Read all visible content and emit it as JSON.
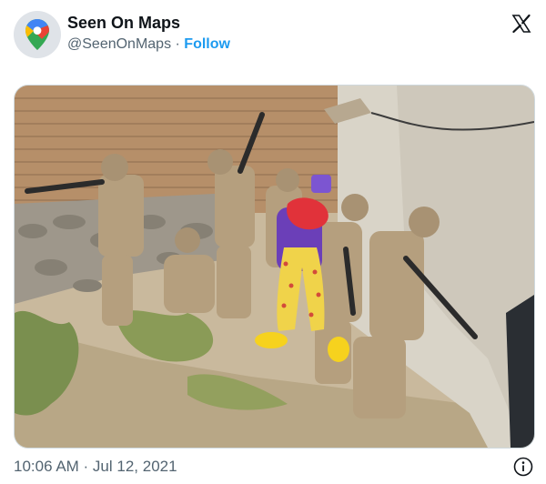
{
  "account": {
    "name": "Seen On Maps",
    "handle": "@SeenOnMaps",
    "separator": " · ",
    "follow_label": "Follow",
    "avatar_icon": "google-maps-pin-icon"
  },
  "header": {
    "platform_icon": "x-logo-icon"
  },
  "post": {
    "image_icon": "photo",
    "timestamp": "10:06 AM · Jul 12, 2021",
    "info_icon": "info-icon"
  },
  "colors": {
    "accent": "#1d9bf0",
    "muted": "#536471",
    "text": "#0f1419"
  }
}
